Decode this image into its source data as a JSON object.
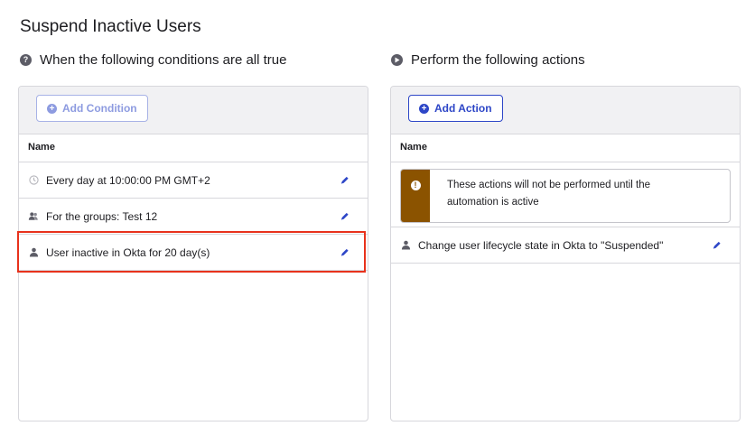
{
  "page": {
    "title": "Suspend Inactive Users"
  },
  "conditions": {
    "heading": "When the following conditions are all true",
    "heading_icon": "help-circle-icon",
    "add_button_label": "Add Condition",
    "column_header": "Name",
    "rows": [
      {
        "text": "Every day at 10:00:00 PM GMT+2",
        "icon": "clock-icon"
      },
      {
        "text": "For the groups: Test 12",
        "icon": "group-icon"
      },
      {
        "text": "User inactive in Okta for 20 day(s)",
        "icon": "user-icon"
      }
    ]
  },
  "actions": {
    "heading": "Perform the following actions",
    "heading_icon": "play-circle-icon",
    "add_button_label": "Add Action",
    "column_header": "Name",
    "warning_text": "These actions will not be performed until the automation is active",
    "rows": [
      {
        "text": "Change user lifecycle state in Okta to \"Suspended\"",
        "icon": "user-icon"
      }
    ]
  },
  "colors": {
    "accent": "#2d46c7",
    "warning": "#8b5300",
    "highlight": "#e8321c"
  }
}
